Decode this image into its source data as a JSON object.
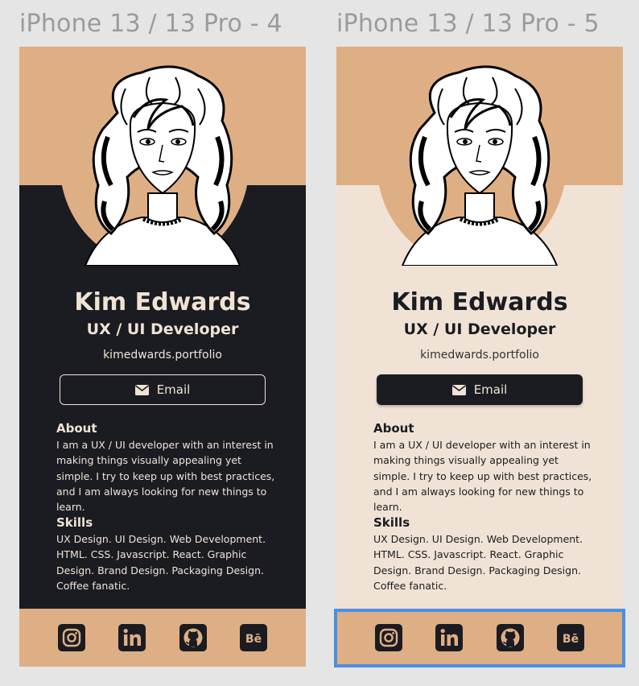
{
  "frames": [
    {
      "title": "iPhone 13 / 13 Pro - 4",
      "theme": "dark",
      "profile": {
        "name": "Kim Edwards",
        "role": "UX / UI Developer",
        "website": "kimedwards.portfolio",
        "email_label": "Email"
      },
      "about": {
        "heading": "About",
        "text": "I am a UX / UI developer with an interest in making things visually appealing yet simple. I try to keep up with best practices, and I am always looking for new things to learn."
      },
      "skills": {
        "heading": "Skills",
        "text": "UX Design. UI Design. Web Development. HTML. CSS. Javascript. React. Graphic Design. Brand Design. Packaging Design. Coffee fanatic."
      },
      "social_icons": [
        "instagram-icon",
        "linkedin-icon",
        "github-icon",
        "behance-icon"
      ]
    },
    {
      "title": "iPhone 13 / 13 Pro - 5",
      "theme": "light",
      "profile": {
        "name": "Kim Edwards",
        "role": "UX / UI Developer",
        "website": "kimedwards.portfolio",
        "email_label": "Email"
      },
      "about": {
        "heading": "About",
        "text": "I am a UX / UI developer with an interest in making things visually appealing yet simple. I try to keep up with best practices, and I am always looking for new things to learn."
      },
      "skills": {
        "heading": "Skills",
        "text": "UX Design. UI Design. Web Development. HTML. CSS. Javascript. React. Graphic Design. Brand Design. Packaging Design. Coffee fanatic."
      },
      "social_icons": [
        "instagram-icon",
        "linkedin-icon",
        "github-icon",
        "behance-icon"
      ]
    }
  ],
  "colors": {
    "accent": "#deaf85",
    "dark": "#1b1c21",
    "light": "#f0e3d6",
    "selection": "#4a90e2"
  }
}
